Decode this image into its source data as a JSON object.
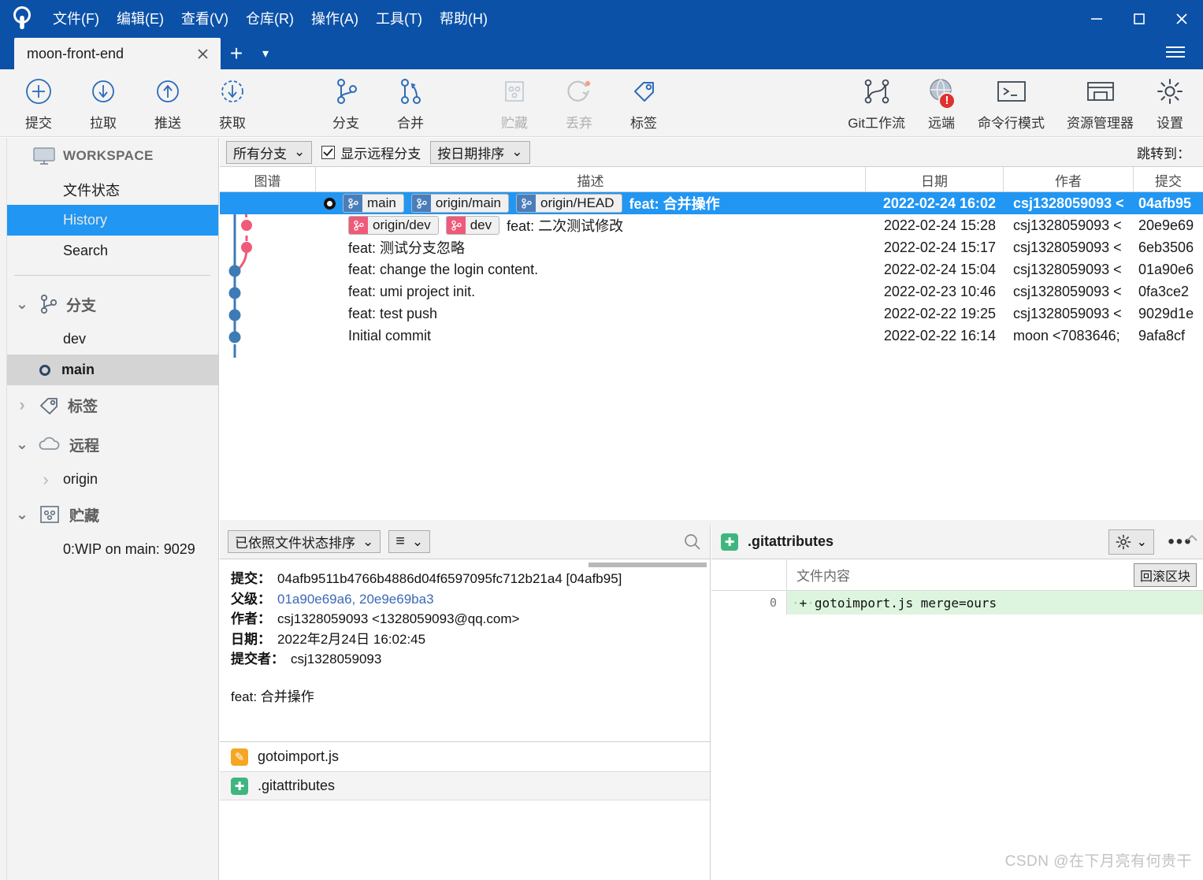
{
  "window": {
    "logo_icon": "sourcetree-logo-icon",
    "menus": [
      {
        "label": "文件(F)",
        "name": "menu-file"
      },
      {
        "label": "编辑(E)",
        "name": "menu-edit"
      },
      {
        "label": "查看(V)",
        "name": "menu-view"
      },
      {
        "label": "仓库(R)",
        "name": "menu-repository"
      },
      {
        "label": "操作(A)",
        "name": "menu-actions"
      },
      {
        "label": "工具(T)",
        "name": "menu-tools"
      },
      {
        "label": "帮助(H)",
        "name": "menu-help"
      }
    ],
    "controls": {
      "minimize": "—",
      "maximize": "□",
      "close": "✕"
    },
    "titlebar_color": "#0b51a8"
  },
  "tabs": {
    "items": [
      {
        "label": "moon-front-end",
        "active": true
      }
    ],
    "close_glyph": "✕",
    "new_tab_glyph": "+",
    "dropdown_glyph": "▾"
  },
  "toolbar": {
    "left_items": [
      {
        "label": "提交",
        "icon": "commit-plus-circle-icon",
        "disabled": false
      },
      {
        "label": "拉取",
        "icon": "pull-down-arrow-icon",
        "disabled": false
      },
      {
        "label": "推送",
        "icon": "push-up-arrow-icon",
        "disabled": false
      },
      {
        "label": "获取",
        "icon": "fetch-dashed-circle-icon",
        "disabled": false
      },
      {
        "label": "分支",
        "icon": "branch-icon",
        "disabled": false
      },
      {
        "label": "合并",
        "icon": "merge-icon",
        "disabled": false
      },
      {
        "label": "贮藏",
        "icon": "stash-icon",
        "disabled": true
      },
      {
        "label": "丢弃",
        "icon": "discard-icon",
        "disabled": true
      },
      {
        "label": "标签",
        "icon": "tag-icon",
        "disabled": false
      }
    ],
    "right_items": [
      {
        "label": "Git工作流",
        "icon": "gitflow-icon",
        "disabled": false,
        "badge": ""
      },
      {
        "label": "远端",
        "icon": "remote-globe-icon",
        "disabled": false,
        "badge": "!"
      },
      {
        "label": "命令行模式",
        "icon": "terminal-icon",
        "disabled": false,
        "badge": ""
      },
      {
        "label": "资源管理器",
        "icon": "explorer-folder-icon",
        "disabled": false,
        "badge": ""
      },
      {
        "label": "设置",
        "icon": "gear-icon",
        "disabled": false,
        "badge": ""
      }
    ]
  },
  "sidebar": {
    "workspace": {
      "label": "WORKSPACE",
      "icon": "monitor-icon"
    },
    "workspace_items": [
      {
        "label": "文件状态",
        "name": "sidebar-item-file-status",
        "selected": false
      },
      {
        "label": "History",
        "name": "sidebar-item-history",
        "selected": true
      },
      {
        "label": "Search",
        "name": "sidebar-item-search",
        "selected": false
      }
    ],
    "branches": {
      "label": "分支",
      "icon": "branch-icon",
      "expanded": true,
      "chevron": "⌄",
      "items": [
        {
          "label": "dev",
          "current": false
        },
        {
          "label": "main",
          "current": true
        }
      ]
    },
    "tags": {
      "label": "标签",
      "icon": "tag-icon",
      "expanded": false,
      "chevron": "›"
    },
    "remotes": {
      "label": "远程",
      "icon": "cloud-icon",
      "expanded": true,
      "chevron": "⌄",
      "items": [
        {
          "label": "origin",
          "chevron": "›"
        }
      ]
    },
    "stashes": {
      "label": "贮藏",
      "icon": "stash-icon",
      "expanded": true,
      "chevron": "⌄",
      "items": [
        {
          "label": "0:WIP on main: 9029"
        }
      ]
    }
  },
  "history": {
    "filters": {
      "branch_filter": {
        "value": "所有分支",
        "caret": "⌄"
      },
      "show_remote_branches": {
        "label": "显示远程分支",
        "checked": true,
        "check_glyph": "✓"
      },
      "sort": {
        "value": "按日期排序",
        "caret": "⌄"
      }
    },
    "jump_to_label": "跳转到：",
    "columns": [
      {
        "key": "graph",
        "label": "图谱"
      },
      {
        "key": "description",
        "label": "描述"
      },
      {
        "key": "date",
        "label": "日期"
      },
      {
        "key": "author",
        "label": "作者"
      },
      {
        "key": "commit",
        "label": "提交"
      }
    ],
    "rows": [
      {
        "selected": true,
        "head": true,
        "refs": [
          {
            "name": "main",
            "color": "blue"
          },
          {
            "name": "origin/main",
            "color": "blue"
          },
          {
            "name": "origin/HEAD",
            "color": "blue"
          }
        ],
        "message": "feat: 合并操作",
        "date": "2022-02-24 16:02",
        "author": "csj1328059093 <",
        "commit": "04afb95"
      },
      {
        "selected": false,
        "head": false,
        "refs": [
          {
            "name": "origin/dev",
            "color": "pink"
          },
          {
            "name": "dev",
            "color": "pink"
          }
        ],
        "message": "feat: 二次测试修改",
        "date": "2022-02-24 15:28",
        "author": "csj1328059093 <",
        "commit": "20e9e69"
      },
      {
        "selected": false,
        "head": false,
        "refs": [],
        "message": "feat: 测试分支忽略",
        "date": "2022-02-24 15:17",
        "author": "csj1328059093 <",
        "commit": "6eb3506"
      },
      {
        "selected": false,
        "head": false,
        "refs": [],
        "message": "feat: change the login content.",
        "date": "2022-02-24 15:04",
        "author": "csj1328059093 <",
        "commit": "01a90e6"
      },
      {
        "selected": false,
        "head": false,
        "refs": [],
        "message": "feat: umi project init.",
        "date": "2022-02-23 10:46",
        "author": "csj1328059093 <",
        "commit": "0fa3ce2"
      },
      {
        "selected": false,
        "head": false,
        "refs": [],
        "message": "feat: test push",
        "date": "2022-02-22 19:25",
        "author": "csj1328059093 <",
        "commit": "9029d1e"
      },
      {
        "selected": false,
        "head": false,
        "refs": [],
        "message": "Initial commit",
        "date": "2022-02-22 16:14",
        "author": "moon <7083646;",
        "commit": "9afa8cf"
      }
    ]
  },
  "detail": {
    "sort_dropdown": {
      "value": "已依照文件状态排序",
      "caret": "⌄"
    },
    "view_dropdown": {
      "value": "≡",
      "caret": "⌄"
    },
    "search_icon": "search-icon",
    "fields": [
      {
        "key": "提交：",
        "value": "04afb9511b4766b4886d04f6597095fc712b21a4 [04afb95]",
        "link": false
      },
      {
        "key": "父级：",
        "value": "01a90e69a6, 20e9e69ba3",
        "link": true
      },
      {
        "key": "作者：",
        "value": "csj1328059093 <1328059093@qq.com>",
        "link": false
      },
      {
        "key": "日期：",
        "value": "2022年2月24日 16:02:45",
        "link": false
      },
      {
        "key": "提交者：",
        "value": "csj1328059093",
        "link": false
      }
    ],
    "commit_message": "feat: 合并操作",
    "files": [
      {
        "name": "gotoimport.js",
        "status": "modified",
        "status_glyph": "✎",
        "selected": false
      },
      {
        "name": ".gitattributes",
        "status": "added",
        "status_glyph": "✚",
        "selected": true
      }
    ]
  },
  "diff": {
    "file_name": ".gitattributes",
    "file_status": "added",
    "file_status_glyph": "✚",
    "gear_icon": "gear-icon",
    "gear_caret": "⌄",
    "more_glyph": "•••",
    "content_header": "文件内容",
    "rollback_button": "回滚区块",
    "lines": [
      {
        "num": "0",
        "prefix": "+",
        "text": "gotoimport.js merge=ours",
        "type": "added"
      }
    ]
  },
  "watermark": "CSDN @在下月亮有何贵干",
  "colors": {
    "title_blue": "#0b51a8",
    "selection_blue": "#2196f3",
    "branch_blue": "#4a7ebb",
    "branch_pink": "#ef5a78",
    "icon_blue": "#2b6cb8",
    "added_green": "#ddf5de",
    "badge_red": "#e03030"
  }
}
